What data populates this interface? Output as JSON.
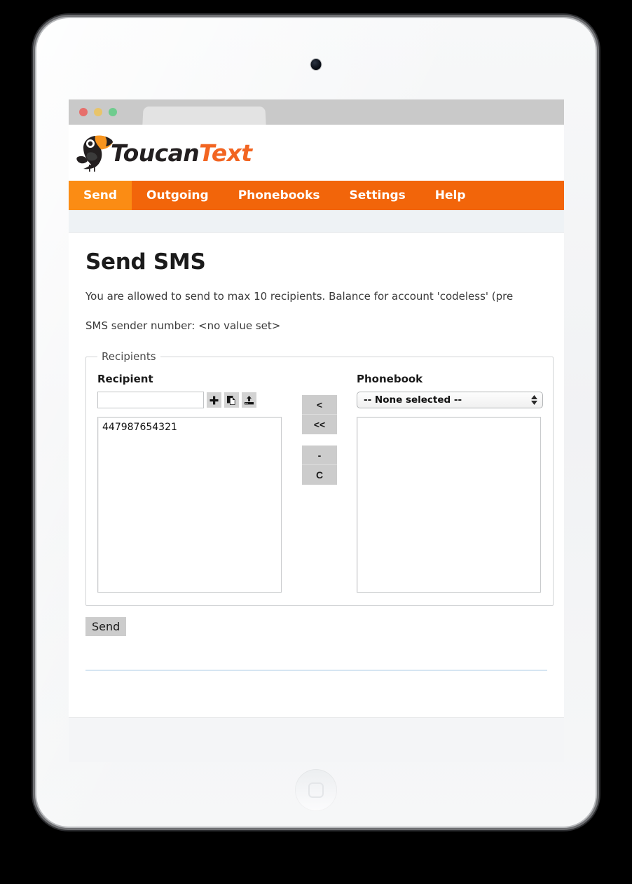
{
  "browser": {
    "traffic_lights": [
      "close",
      "minimize",
      "maximize"
    ],
    "tab_label": ""
  },
  "site": {
    "logo": {
      "word_primary": "Toucan",
      "word_accent": "Text",
      "icon": "toucan-bird-icon"
    },
    "nav": {
      "items": [
        {
          "label": "Send",
          "active": true
        },
        {
          "label": "Outgoing",
          "active": false
        },
        {
          "label": "Phonebooks",
          "active": false
        },
        {
          "label": "Settings",
          "active": false
        },
        {
          "label": "Help",
          "active": false
        }
      ]
    }
  },
  "page": {
    "title": "Send SMS",
    "info_balance": "You are allowed to send to max 10 recipients. Balance for account 'codeless' (pre",
    "info_sender": "SMS sender number: <no value set>"
  },
  "recipients": {
    "legend": "Recipients",
    "recipient_label": "Recipient",
    "recipient_input_value": "",
    "recipient_input_placeholder": "",
    "icon_buttons": [
      {
        "name": "add-recipient-button",
        "icon": "plus-icon"
      },
      {
        "name": "paste-recipients-button",
        "icon": "copy-pages-icon"
      },
      {
        "name": "upload-recipients-button",
        "icon": "upload-icon"
      }
    ],
    "recipient_list": [
      "447987654321"
    ],
    "transfer_buttons_top": [
      "<",
      "<<"
    ],
    "transfer_buttons_bottom": [
      "-",
      "C"
    ],
    "phonebook_label": "Phonebook",
    "phonebook_selected": "-- None selected --",
    "phonebook_options": [
      "-- None selected --"
    ],
    "phonebook_list": []
  },
  "actions": {
    "send_label": "Send"
  },
  "colors": {
    "nav_orange": "#f2650a",
    "nav_active_orange": "#fb8c14",
    "logo_accent": "#f26522",
    "subbar": "#eef2f5",
    "rule": "#d6e6f2"
  }
}
